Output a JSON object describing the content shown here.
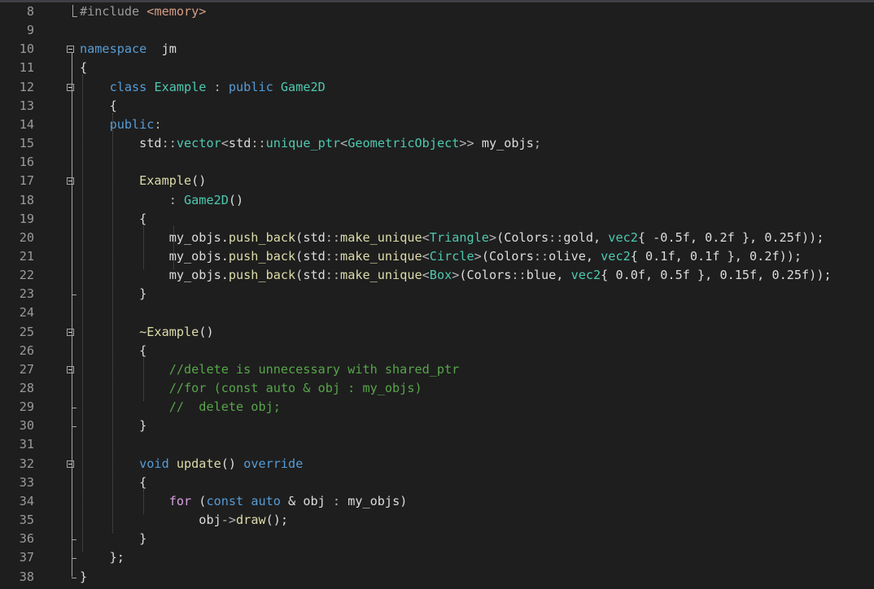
{
  "editor": {
    "lines": [
      {
        "n": "8",
        "tokens": [
          [
            "pre",
            "#include "
          ],
          [
            "str",
            "<memory>"
          ]
        ]
      },
      {
        "n": "9",
        "tokens": []
      },
      {
        "n": "10",
        "tokens": [
          [
            "kw",
            "namespace"
          ],
          [
            "",
            "  jm"
          ]
        ]
      },
      {
        "n": "11",
        "tokens": [
          [
            "",
            "{"
          ]
        ]
      },
      {
        "n": "12",
        "tokens": [
          [
            "",
            "    "
          ],
          [
            "kw",
            "class"
          ],
          [
            "",
            ""
          ],
          [
            "typ",
            " Example"
          ],
          [
            "op",
            " : "
          ],
          [
            "kw",
            "public"
          ],
          [
            "typ",
            " Game2D"
          ]
        ]
      },
      {
        "n": "13",
        "tokens": [
          [
            "",
            "    {"
          ]
        ]
      },
      {
        "n": "14",
        "tokens": [
          [
            "",
            "    "
          ],
          [
            "kw",
            "public"
          ],
          [
            "op",
            ":"
          ]
        ]
      },
      {
        "n": "15",
        "tokens": [
          [
            "",
            "        std"
          ],
          [
            "op",
            "::"
          ],
          [
            "typ",
            "vector"
          ],
          [
            "op",
            "<"
          ],
          [
            "",
            "std"
          ],
          [
            "op",
            "::"
          ],
          [
            "typ",
            "unique_ptr"
          ],
          [
            "op",
            "<"
          ],
          [
            "typ",
            "GeometricObject"
          ],
          [
            "op",
            ">>"
          ],
          [
            "",
            " my_objs"
          ],
          [
            "op",
            ";"
          ]
        ]
      },
      {
        "n": "16",
        "tokens": []
      },
      {
        "n": "17",
        "tokens": [
          [
            "fn",
            "        Example"
          ],
          [
            "",
            "()"
          ]
        ]
      },
      {
        "n": "18",
        "tokens": [
          [
            "op",
            "            : "
          ],
          [
            "typ",
            "Game2D"
          ],
          [
            "",
            "()"
          ]
        ]
      },
      {
        "n": "19",
        "tokens": [
          [
            "",
            "        {"
          ]
        ]
      },
      {
        "n": "20",
        "tokens": [
          [
            "",
            "            my_objs."
          ],
          [
            "fn",
            "push_back"
          ],
          [
            "",
            "(std"
          ],
          [
            "op",
            "::"
          ],
          [
            "fn",
            "make_unique"
          ],
          [
            "op",
            "<"
          ],
          [
            "typ",
            "Triangle"
          ],
          [
            "op",
            ">"
          ],
          [
            "",
            "(Colors"
          ],
          [
            "op",
            "::"
          ],
          [
            "",
            "gold, "
          ],
          [
            "typ",
            "vec2"
          ],
          [
            "",
            "{ -0.5f, 0.2f }, 0.25f));"
          ]
        ]
      },
      {
        "n": "21",
        "tokens": [
          [
            "",
            "            my_objs."
          ],
          [
            "fn",
            "push_back"
          ],
          [
            "",
            "(std"
          ],
          [
            "op",
            "::"
          ],
          [
            "fn",
            "make_unique"
          ],
          [
            "op",
            "<"
          ],
          [
            "typ",
            "Circle"
          ],
          [
            "op",
            ">"
          ],
          [
            "",
            "(Colors"
          ],
          [
            "op",
            "::"
          ],
          [
            "",
            "olive, "
          ],
          [
            "typ",
            "vec2"
          ],
          [
            "",
            "{ 0.1f, 0.1f }, 0.2f));"
          ]
        ]
      },
      {
        "n": "22",
        "tokens": [
          [
            "",
            "            my_objs."
          ],
          [
            "fn",
            "push_back"
          ],
          [
            "",
            "(std"
          ],
          [
            "op",
            "::"
          ],
          [
            "fn",
            "make_unique"
          ],
          [
            "op",
            "<"
          ],
          [
            "typ",
            "Box"
          ],
          [
            "op",
            ">"
          ],
          [
            "",
            "(Colors"
          ],
          [
            "op",
            "::"
          ],
          [
            "",
            "blue, "
          ],
          [
            "typ",
            "vec2"
          ],
          [
            "",
            "{ 0.0f, 0.5f }, 0.15f, 0.25f));"
          ]
        ]
      },
      {
        "n": "23",
        "tokens": [
          [
            "",
            "        }"
          ]
        ]
      },
      {
        "n": "24",
        "tokens": []
      },
      {
        "n": "25",
        "tokens": [
          [
            "fn",
            "        ~Example"
          ],
          [
            "",
            "()"
          ]
        ]
      },
      {
        "n": "26",
        "tokens": [
          [
            "",
            "        {"
          ]
        ]
      },
      {
        "n": "27",
        "tokens": [
          [
            "cmt",
            "            //delete is unnecessary with shared_ptr"
          ]
        ]
      },
      {
        "n": "28",
        "tokens": [
          [
            "cmt",
            "            //for (const auto & obj : my_objs)"
          ]
        ]
      },
      {
        "n": "29",
        "tokens": [
          [
            "cmt",
            "            //  delete obj;"
          ]
        ]
      },
      {
        "n": "30",
        "tokens": [
          [
            "",
            "        }"
          ]
        ]
      },
      {
        "n": "31",
        "tokens": []
      },
      {
        "n": "32",
        "tokens": [
          [
            "kw",
            "        void"
          ],
          [
            "fn",
            " update"
          ],
          [
            "",
            "() "
          ],
          [
            "kw",
            "override"
          ]
        ]
      },
      {
        "n": "33",
        "tokens": [
          [
            "",
            "        {"
          ]
        ]
      },
      {
        "n": "34",
        "tokens": [
          [
            "ctl",
            "            for"
          ],
          [
            "",
            " ("
          ],
          [
            "kw",
            "const"
          ],
          [
            "kw",
            " auto"
          ],
          [
            "",
            " & obj "
          ],
          [
            "op",
            ":"
          ],
          [
            "",
            " my_objs)"
          ]
        ]
      },
      {
        "n": "35",
        "tokens": [
          [
            "",
            "                obj"
          ],
          [
            "op",
            "->"
          ],
          [
            "fn",
            "draw"
          ],
          [
            "",
            "();"
          ]
        ]
      },
      {
        "n": "36",
        "tokens": [
          [
            "",
            "        }"
          ]
        ]
      },
      {
        "n": "37",
        "tokens": [
          [
            "",
            "    };"
          ]
        ]
      },
      {
        "n": "38",
        "tokens": [
          [
            "",
            "}"
          ]
        ]
      }
    ],
    "folds": [
      "10",
      "12",
      "17",
      "25",
      "27",
      "32"
    ]
  }
}
